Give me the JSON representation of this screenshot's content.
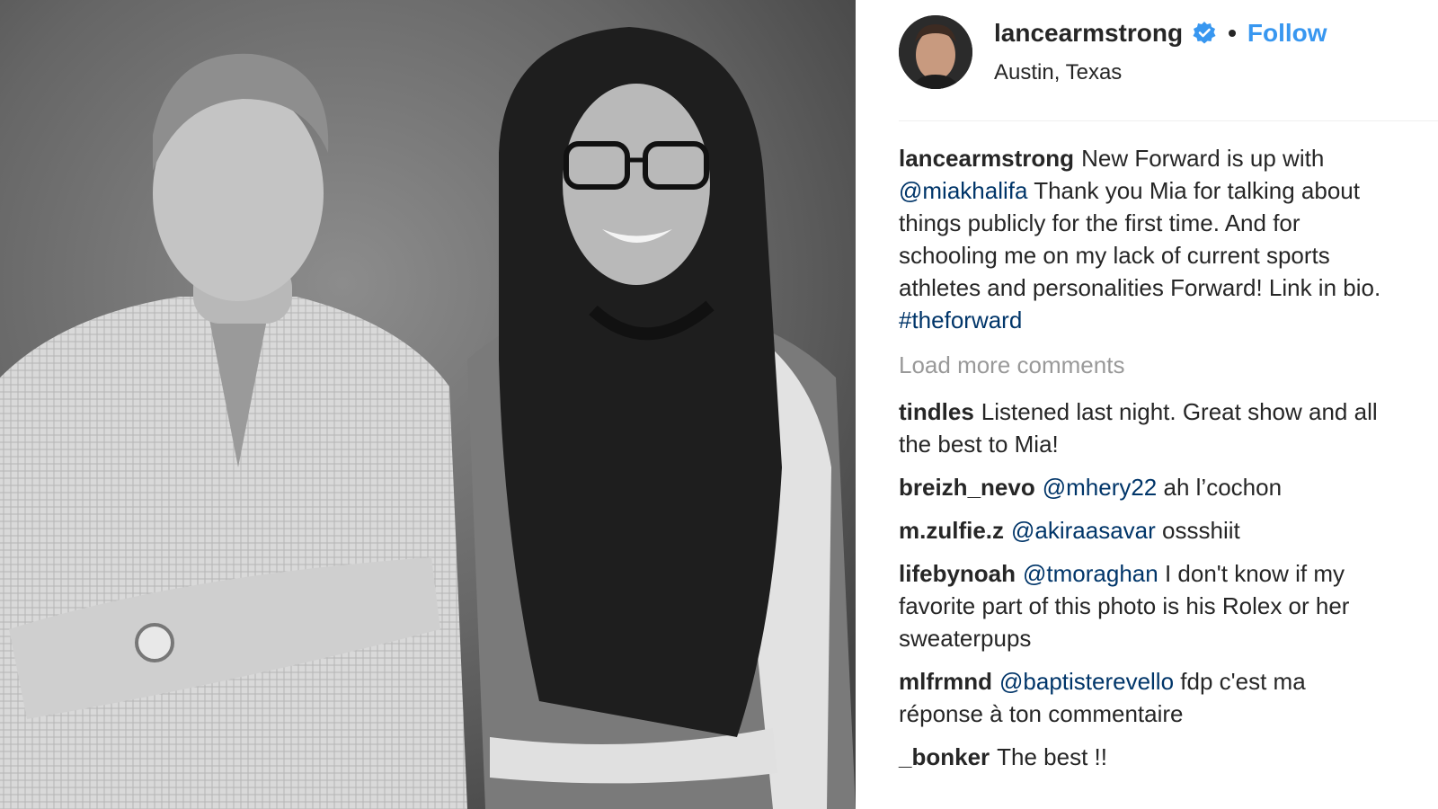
{
  "header": {
    "username": "lancearmstrong",
    "verified_icon": "verified-badge-icon",
    "separator": "•",
    "follow_label": "Follow",
    "location": "Austin, Texas"
  },
  "caption": {
    "username": "lancearmstrong",
    "text_1": "New Forward is up with",
    "mention": "@miakhalifa",
    "text_2": "Thank you Mia for talking about things publicly for the first time. And for schooling me on my lack of current sports athletes and personalities Forward! Link in bio.",
    "hashtag": "#theforward"
  },
  "load_more_label": "Load more comments",
  "comments": [
    {
      "username": "tindles",
      "mention": "",
      "text": "Listened last night. Great show and all the best to Mia!"
    },
    {
      "username": "breizh_nevo",
      "mention": "@mhery22",
      "text": "ah l’cochon"
    },
    {
      "username": "m.zulfie.z",
      "mention": "@akiraasavar",
      "text": "ossshiit"
    },
    {
      "username": "lifebynoah",
      "mention": "@tmoraghan",
      "text": "I don't know if my favorite part of this photo is his Rolex or her sweaterpups"
    },
    {
      "username": "mlfrmnd",
      "mention": "@baptisterevello",
      "text": "fdp c'est ma réponse à ton commentaire"
    },
    {
      "username": "_bonker",
      "mention": "",
      "text": "The best !!"
    }
  ],
  "colors": {
    "link": "#3897f0",
    "mention": "#003569",
    "muted": "#999999",
    "text": "#262626"
  }
}
